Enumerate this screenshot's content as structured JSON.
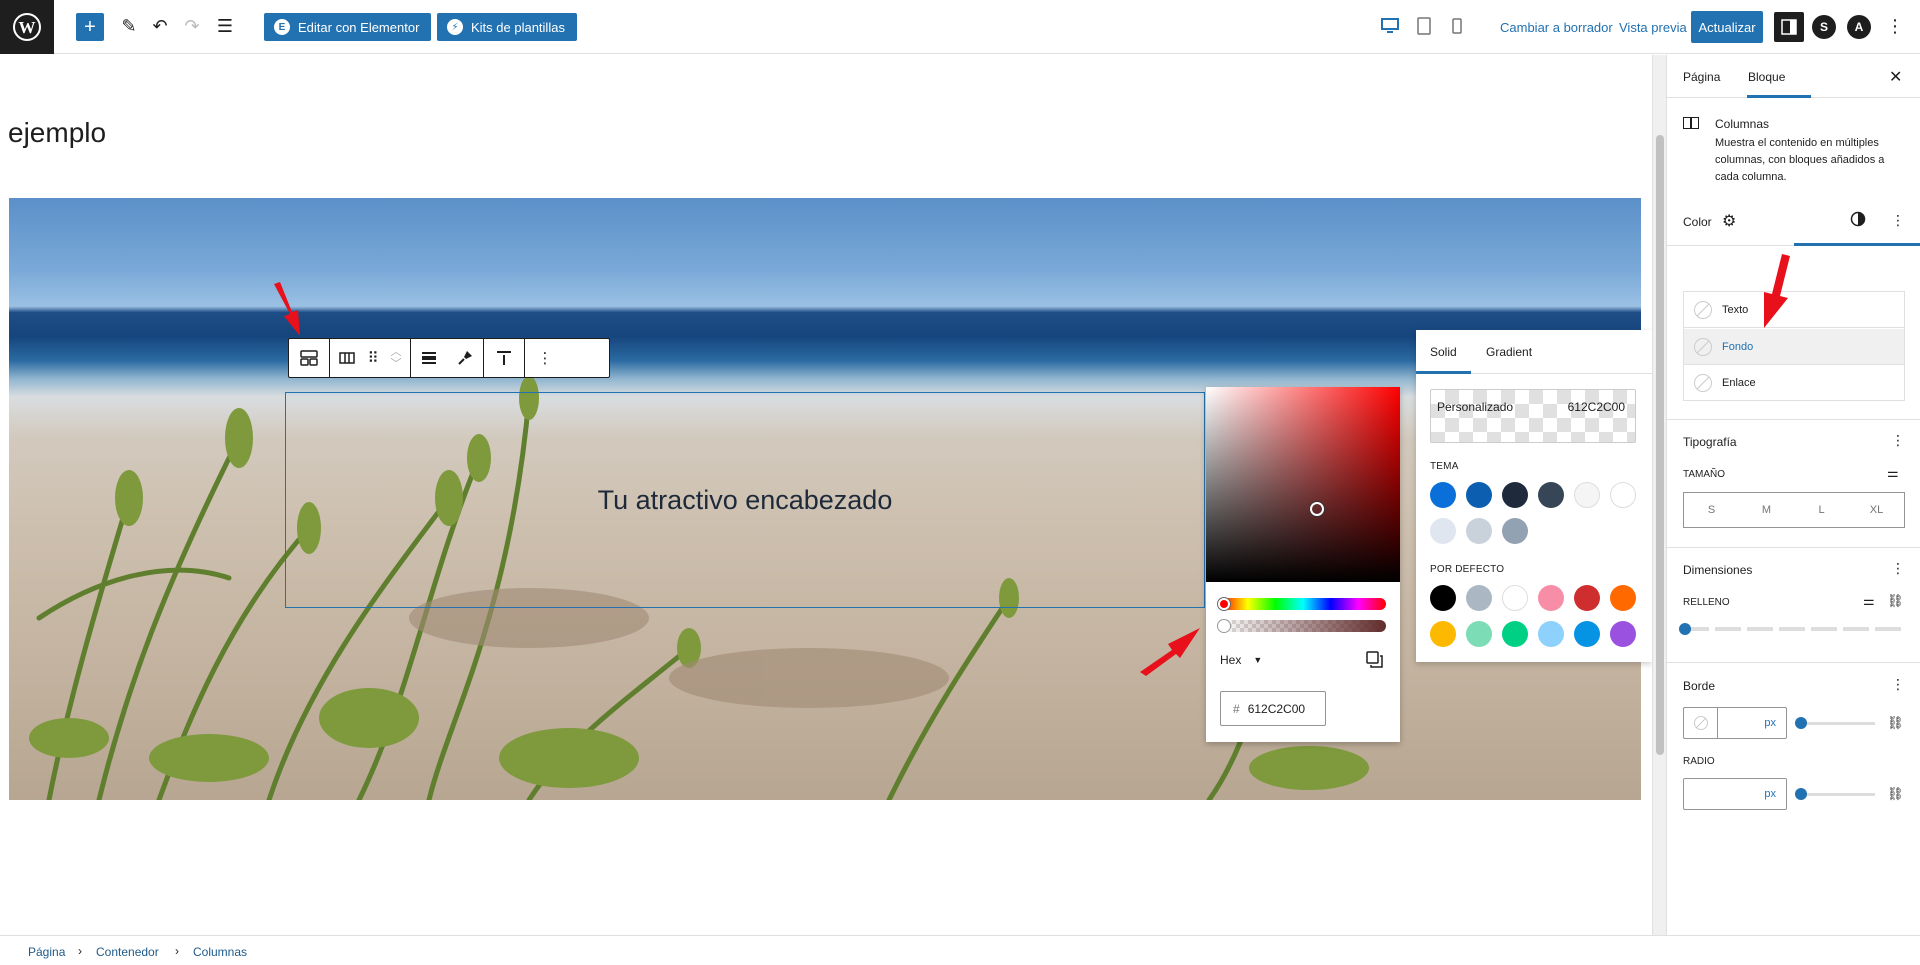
{
  "topbar": {
    "elementor_label": "Editar con Elementor",
    "kits_label": "Kits de plantillas",
    "switch_draft": "Cambiar a borrador",
    "preview": "Vista previa",
    "update": "Actualizar"
  },
  "canvas": {
    "post_title": "ejemplo",
    "heading": "Tu atractivo encabezado"
  },
  "picker": {
    "format": "Hex",
    "hex_value": "612C2C00",
    "hash": "#"
  },
  "swatches": {
    "tab_solid": "Solid",
    "tab_gradient": "Gradient",
    "custom_label": "Personalizado",
    "custom_value": "612C2C00",
    "theme_heading": "Tema",
    "default_heading": "Por defecto",
    "theme": [
      "#0a6fd9",
      "#0c5eb0",
      "#1f2a3c",
      "#374656",
      "#f5f5f5",
      "#ffffff",
      "#dfe6ef",
      "#c9d2db",
      "#93a2b2"
    ],
    "default": [
      "#000000",
      "#abb8c3",
      "#ffffff",
      "#f78da7",
      "#cf2e2e",
      "#ff6900",
      "#fcb900",
      "#7bdcb5",
      "#00d084",
      "#8ed1fc",
      "#0693e3",
      "#9b51e0"
    ]
  },
  "sidebar": {
    "tab_page": "Página",
    "tab_block": "Bloque",
    "block_name": "Columnas",
    "block_desc": "Muestra el contenido en múltiples columnas, con bloques añadidos a cada columna.",
    "color_title": "Color",
    "color_items": [
      "Texto",
      "Fondo",
      "Enlace"
    ],
    "typography_title": "Tipografía",
    "size_label": "Tamaño",
    "sizes": [
      "S",
      "M",
      "L",
      "XL"
    ],
    "dimensions_title": "Dimensiones",
    "padding_label": "Relleno",
    "border_title": "Borde",
    "unit_px": "px",
    "radius_label": "Radio"
  },
  "breadcrumb": [
    "Página",
    "Contenedor",
    "Columnas"
  ]
}
